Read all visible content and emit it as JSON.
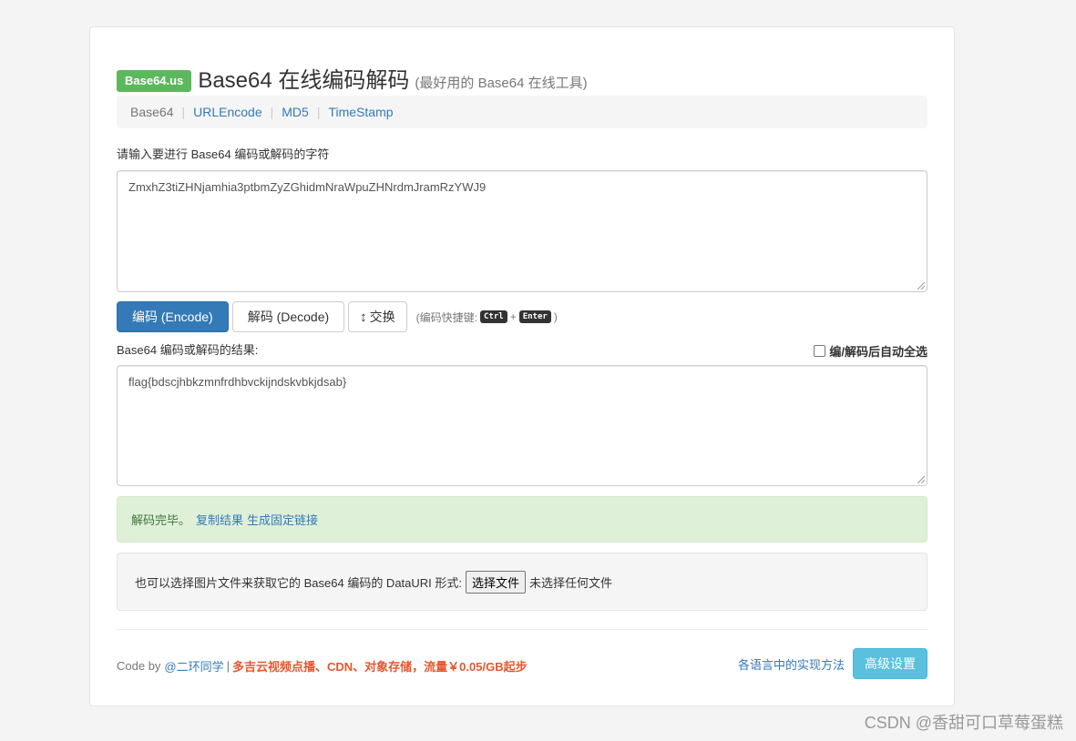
{
  "header": {
    "badge": "Base64.us",
    "title": "Base64 在线编码解码",
    "subtitle": "(最好用的 Base64 在线工具)"
  },
  "nav": {
    "items": [
      {
        "label": "Base64"
      },
      {
        "label": "URLEncode"
      },
      {
        "label": "MD5"
      },
      {
        "label": "TimeStamp"
      }
    ],
    "separator": "|"
  },
  "input": {
    "label": "请输入要进行 Base64 编码或解码的字符",
    "value": "ZmxhZ3tiZHNjamhia3ptbmZyZGhidmNraWpuZHNrdmJramRzYWJ9"
  },
  "buttons": {
    "encode": "编码 (Encode)",
    "decode": "解码 (Decode)",
    "swap_icon": "↕",
    "swap": "交换"
  },
  "shortcut": {
    "prefix": "(编码快捷键:",
    "key1": "Ctrl",
    "plus": "+",
    "key2": "Enter",
    "suffix": ")"
  },
  "output": {
    "label": "Base64 编码或解码的结果:",
    "auto_select_label": "编/解码后自动全选",
    "auto_select_checked": false,
    "value": "flag{bdscjhbkzmnfrdhbvckijndskvbkjdsab}"
  },
  "status": {
    "message": "解码完毕。",
    "copy_link": "复制结果",
    "permalink": "生成固定链接"
  },
  "file": {
    "prompt": "也可以选择图片文件来获取它的 Base64 编码的 DataURI 形式:",
    "button": "选择文件",
    "no_file": "未选择任何文件"
  },
  "footer": {
    "code_by": "Code by",
    "author": "@二环同学",
    "bar": "|",
    "promo": "多吉云视频点播、CDN、对象存储，流量￥0.05/GB起步",
    "impl_link": "各语言中的实现方法",
    "advanced_button": "高级设置"
  },
  "watermark": "CSDN @香甜可口草莓蛋糕",
  "colors": {
    "badge": "#5cb85c",
    "primary": "#337ab7",
    "success_bg": "#dff0d8",
    "info": "#5bc0de",
    "promo": "#e4572e"
  }
}
